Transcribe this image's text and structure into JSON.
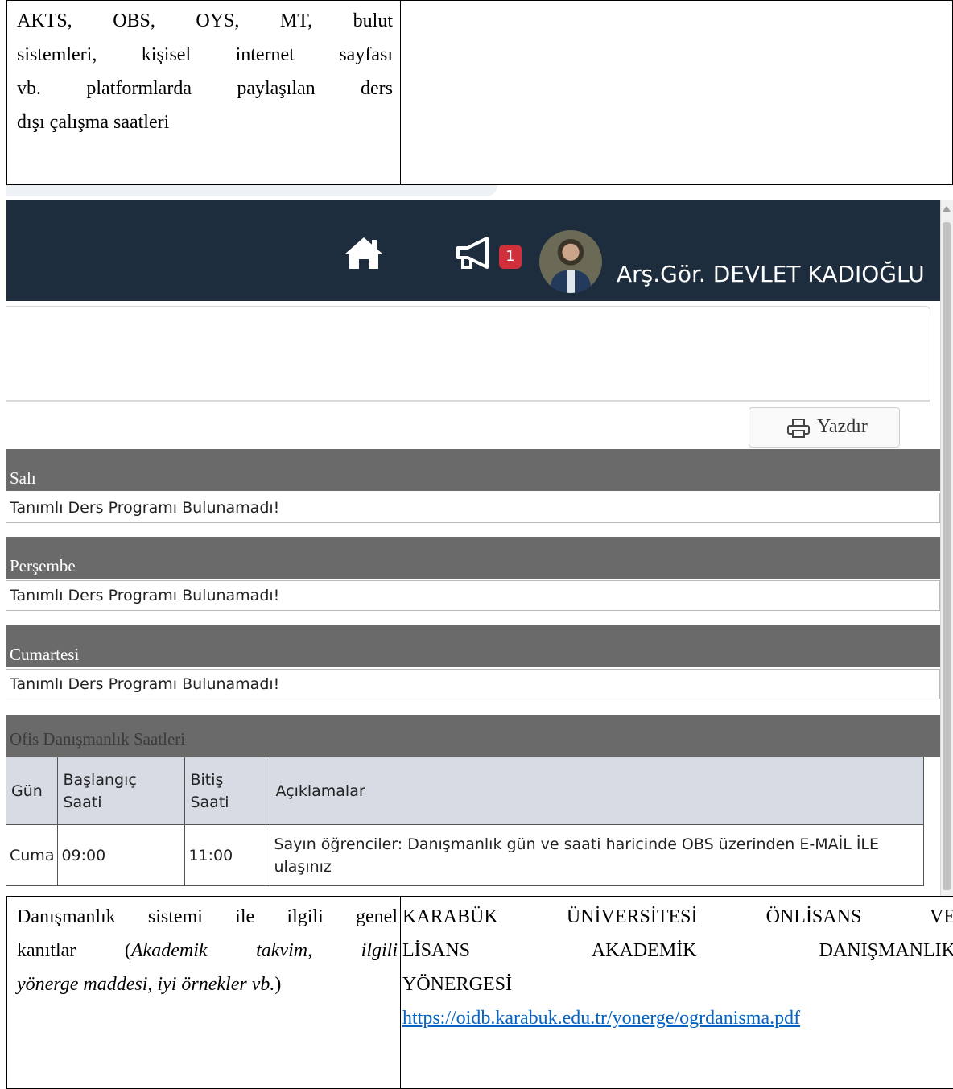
{
  "doc": {
    "top_left_lines": [
      "AKTS, OBS, OYS, MT, bulut",
      "sistemleri, kişisel internet sayfası",
      "vb. platformlarda paylaşılan ders",
      "dışı çalışma saatleri"
    ],
    "bottom_left": {
      "line1": "Danışmanlık sistemi ile ilgili genel",
      "line2_normal": "kanıtlar (",
      "line2_italic": "Akademik takvim, ilgili",
      "line3_italic": "yönerge maddesi, iyi örnekler vb.",
      "line3_end": ")"
    },
    "bottom_right_lines": [
      "KARABÜK ÜNİVERSİTESİ ÖNLİSANS VE",
      "LİSANS AKADEMİK DANIŞMANLIK",
      "YÖNERGESİ"
    ],
    "link": "https://oidb.karabuk.edu.tr/yonerge/ogrdanisma.pdf"
  },
  "app": {
    "header": {
      "notification_count": "1",
      "user_name": "Arş.Gör. DEVLET KADIOĞLU"
    },
    "print_label": "Yazdır",
    "days": [
      {
        "name": "Salı",
        "message": "Tanımlı Ders Programı Bulunamadı!"
      },
      {
        "name": "Perşembe",
        "message": "Tanımlı Ders Programı Bulunamadı!"
      },
      {
        "name": "Cumartesi",
        "message": "Tanımlı Ders Programı Bulunamadı!"
      }
    ],
    "office_hours": {
      "title": "Ofis Danışmanlık Saatleri",
      "columns": [
        "Gün",
        "Başlangıç Saati",
        "Bitiş Saati",
        "Açıklamalar"
      ],
      "rows": [
        {
          "day": "Cuma",
          "start": "09:00",
          "end": "11:00",
          "note": "Sayın öğrenciler: Danışmanlık gün ve saati haricinde OBS üzerinden E-MAİL İLE ulaşınız"
        }
      ]
    },
    "colors": {
      "navbar": "#1d2d3d",
      "day_header": "#6a6a6a",
      "table_header": "#d6dbe4",
      "badge": "#d0303a"
    },
    "icons": [
      "home-icon",
      "megaphone-icon",
      "printer-icon",
      "avatar"
    ]
  }
}
